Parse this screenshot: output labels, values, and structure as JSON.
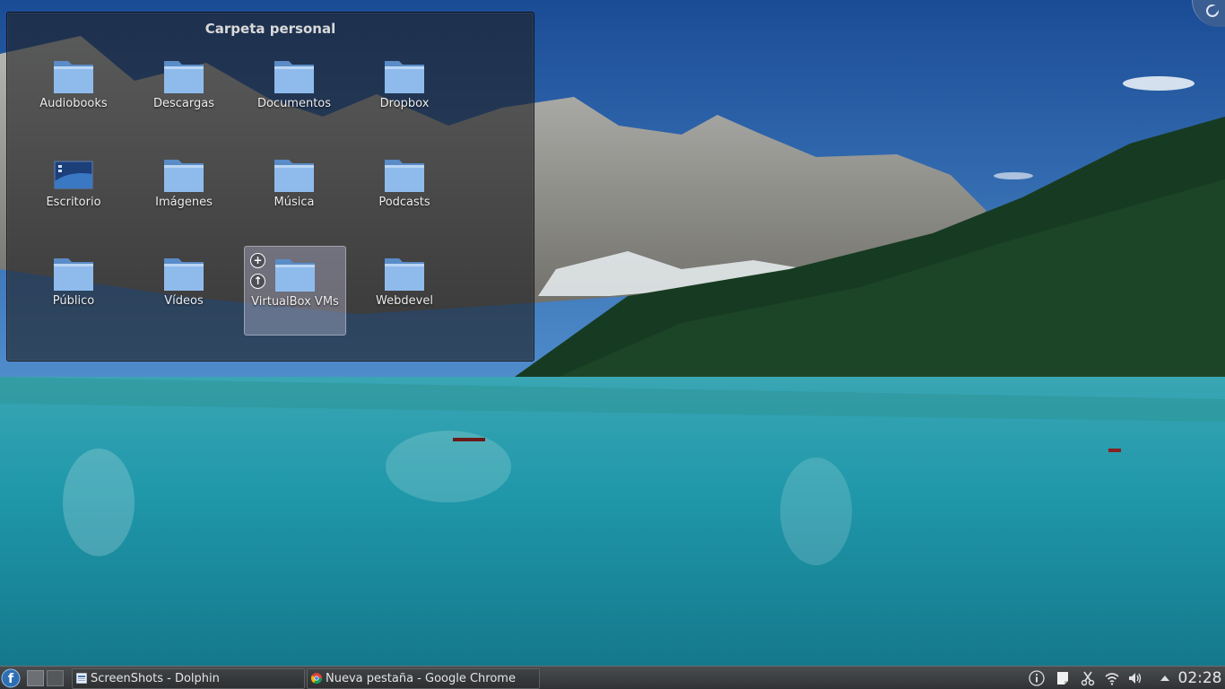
{
  "folderview": {
    "title": "Carpeta personal",
    "items": [
      {
        "label": "Audiobooks",
        "icon": "folder-icon"
      },
      {
        "label": "Descargas",
        "icon": "folder-icon"
      },
      {
        "label": "Documentos",
        "icon": "folder-icon"
      },
      {
        "label": "Dropbox",
        "icon": "folder-icon"
      },
      {
        "label": "Escritorio",
        "icon": "desktop-icon"
      },
      {
        "label": "Imágenes",
        "icon": "folder-icon"
      },
      {
        "label": "Música",
        "icon": "folder-icon"
      },
      {
        "label": "Podcasts",
        "icon": "folder-icon"
      },
      {
        "label": "Público",
        "icon": "folder-icon"
      },
      {
        "label": "Vídeos",
        "icon": "folder-icon"
      },
      {
        "label": "VirtualBox VMs",
        "icon": "folder-icon"
      },
      {
        "label": "Webdevel",
        "icon": "folder-icon"
      }
    ],
    "hover_actions": [
      "+",
      "↑"
    ]
  },
  "taskbar": {
    "tasks": [
      {
        "label": "ScreenShots - Dolphin",
        "icon": "dolphin-icon"
      },
      {
        "label": "Nueva pestaña - Google Chrome",
        "icon": "chrome-icon"
      }
    ],
    "clock": "02:28",
    "tray_icons": [
      "info-icon",
      "notes-icon",
      "scissors-icon",
      "wifi-icon",
      "volume-icon",
      "tray-expand-icon"
    ]
  },
  "colors": {
    "folder": "#7eaee6",
    "panel": "#3a3c3f",
    "accent": "#2d6fb3"
  }
}
